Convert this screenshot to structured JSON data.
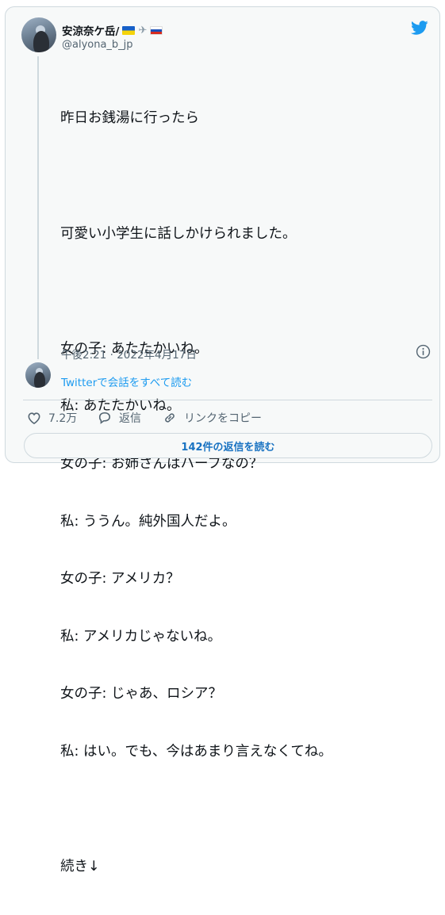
{
  "author": {
    "display_name": "安涼奈ケ岳/",
    "handle": "@alyona_b_jp",
    "flag_icons": [
      "ukraine-flag-icon",
      "airplane-icon",
      "russia-flag-icon"
    ]
  },
  "tweet": {
    "lines": [
      "昨日お銭湯に行ったら",
      "",
      "可愛い小学生に話しかけられました。",
      "",
      "女の子: あたたかいね。",
      "私: あたたかいね。",
      "女の子: お姉さんはハーフなの？",
      "私: ううん。純外国人だよ。",
      "女の子: アメリカ？",
      "私: アメリカじゃないね。",
      "女の子: じゃあ、ロシア？",
      "私: はい。でも、今はあまり言えなくてね。",
      "",
      "続き↓"
    ],
    "timestamp": "午後2:21 · 2022年4月17日"
  },
  "thread_link": "Twitterで会話をすべて読む",
  "actions": {
    "likes": "7.2万",
    "reply_label": "返信",
    "copy_link_label": "リンクをコピー"
  },
  "read_replies_label": "142件の返信を読む",
  "colors": {
    "twitter_blue": "#1d9bf0",
    "text_secondary": "#536471",
    "border": "#cfd9de",
    "card_bg": "#f7f9f9"
  }
}
